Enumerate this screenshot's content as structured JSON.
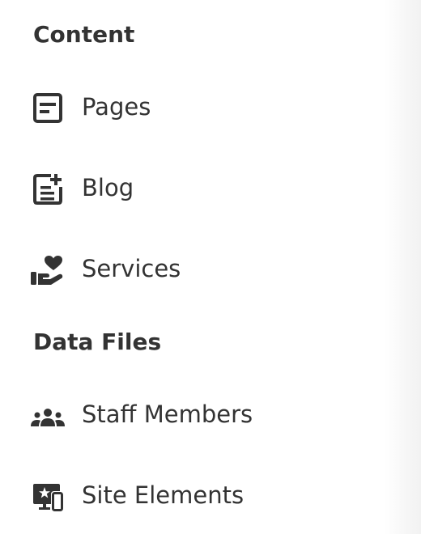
{
  "sidebar": {
    "sections": [
      {
        "heading": "Content",
        "items": [
          {
            "label": "Pages",
            "icon": "page-icon"
          },
          {
            "label": "Blog",
            "icon": "blog-add-icon"
          },
          {
            "label": "Services",
            "icon": "hand-heart-icon"
          }
        ]
      },
      {
        "heading": "Data Files",
        "items": [
          {
            "label": "Staff Members",
            "icon": "people-group-icon"
          },
          {
            "label": "Site Elements",
            "icon": "devices-star-icon"
          }
        ]
      }
    ],
    "colors": {
      "text": "#333333",
      "background": "#ffffff",
      "edge": "#f2f2f2"
    }
  }
}
